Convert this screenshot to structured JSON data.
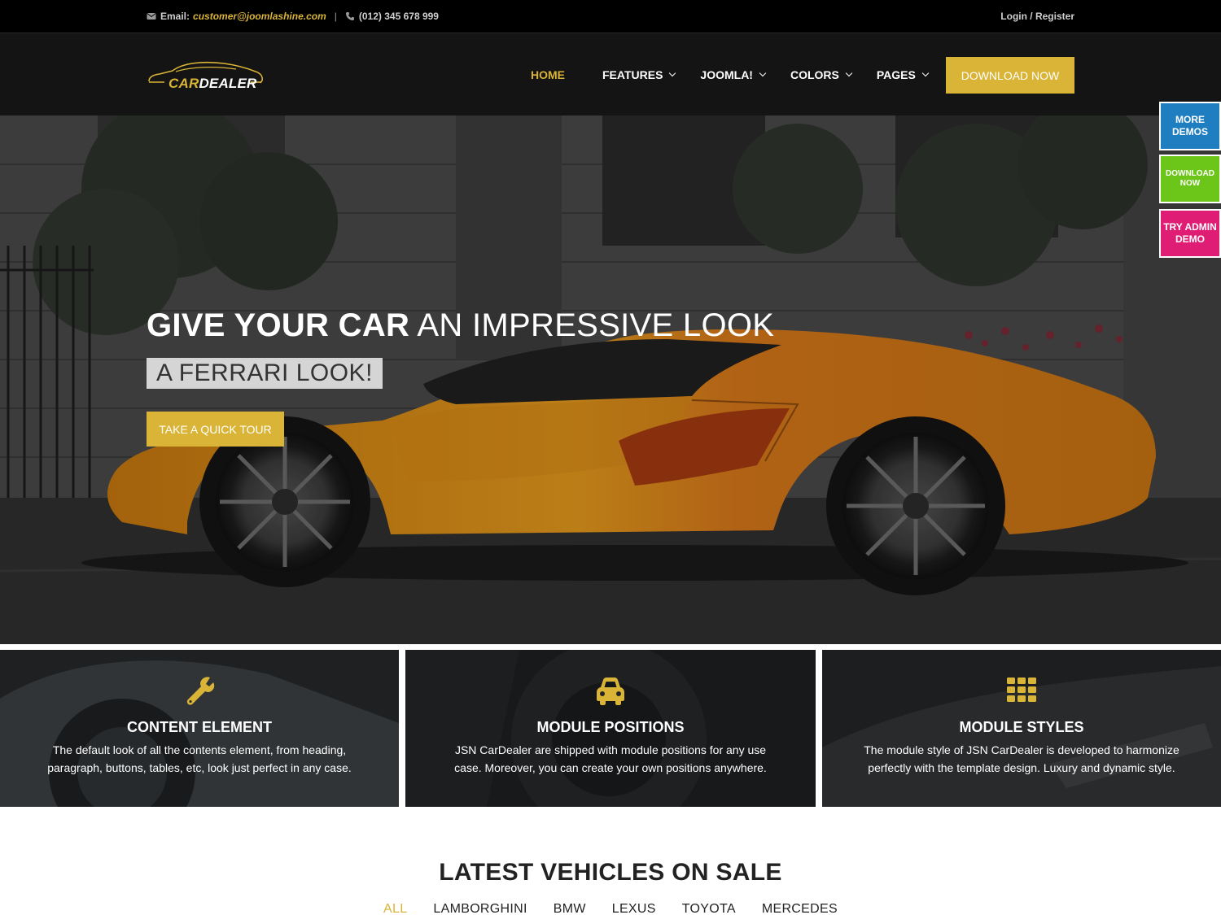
{
  "topbar": {
    "email_label": "Email:",
    "email_value": "customer@joomlashine.com",
    "separator": "|",
    "phone": "(012) 345 678 999",
    "login": "Login",
    "slash": " / ",
    "register": "Register"
  },
  "header": {
    "logo_text_a": "CAR",
    "logo_text_b": "DEALER",
    "nav": [
      {
        "label": "HOME"
      },
      {
        "label": "FEATURES"
      },
      {
        "label": "JOOMLA!"
      },
      {
        "label": "COLORS"
      },
      {
        "label": "PAGES"
      }
    ],
    "download_label": "DOWNLOAD NOW"
  },
  "hero": {
    "title_strong": "GIVE YOUR CAR",
    "title_light": " AN IMPRESSIVE LOOK",
    "subtitle": "A FERRARI LOOK!",
    "tour_label": "TAKE A QUICK TOUR"
  },
  "side_buttons": {
    "more_demos": "MORE DEMOS",
    "download_now": "DOWNLOAD NOW",
    "try_admin": "TRY ADMIN DEMO"
  },
  "features": [
    {
      "title": "CONTENT ELEMENT",
      "text": "The default look of all the contents element, from heading, paragraph, buttons, tables, etc, look just perfect in any case.",
      "icon": "wrench-icon"
    },
    {
      "title": "MODULE POSITIONS",
      "text": "JSN CarDealer are shipped with module positions for any use case. Moreover, you can create your own positions anywhere.",
      "icon": "car-icon"
    },
    {
      "title": "MODULE STYLES",
      "text": "The module style of JSN CarDealer is developed to harmonize perfectly with the template design. Luxury and dynamic style.",
      "icon": "grid-icon"
    }
  ],
  "latest": {
    "title": "LATEST VEHICLES ON SALE",
    "filters": [
      "ALL",
      "LAMBORGHINI",
      "BMW",
      "LEXUS",
      "TOYOTA",
      "MERCEDES"
    ]
  },
  "colors": {
    "accent": "#d9b437",
    "topbar_bg": "#000000",
    "header_bg": "#141414",
    "side_more": "#1f7ec0",
    "side_download": "#6cc61a",
    "side_admin": "#e01d74"
  }
}
